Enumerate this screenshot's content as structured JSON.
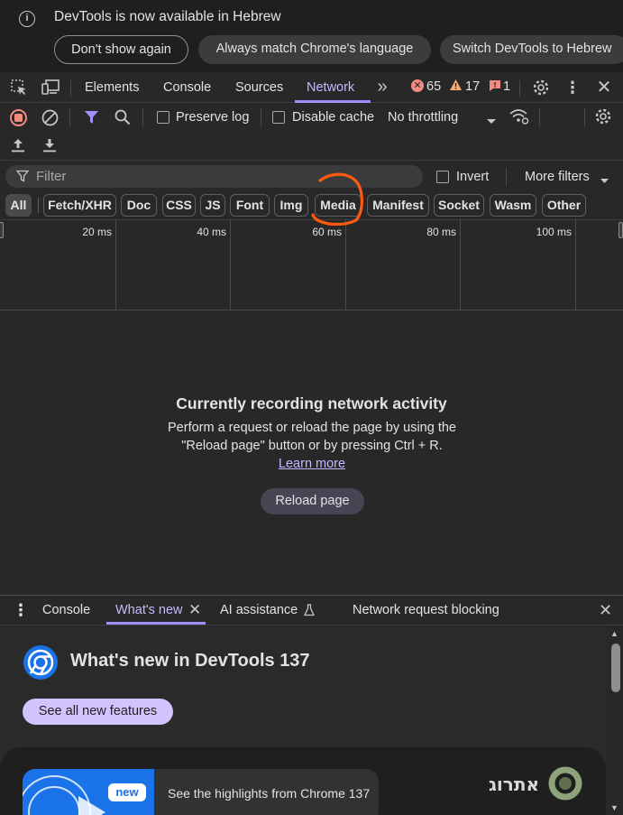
{
  "infobar": {
    "icon": "info-icon",
    "message": "DevTools is now available in Hebrew",
    "dont_show": "Don't show again",
    "always_match": "Always match Chrome's language",
    "switch": "Switch DevTools to Hebrew"
  },
  "tabs": {
    "elements": "Elements",
    "console": "Console",
    "sources": "Sources",
    "network": "Network",
    "more": "»",
    "errors": "65",
    "warnings": "17",
    "issues": "1"
  },
  "toolbar": {
    "preserve_log": "Preserve log",
    "disable_cache": "Disable cache",
    "throttling": "No throttling"
  },
  "filter": {
    "placeholder": "Filter",
    "invert": "Invert",
    "more_filters": "More filters"
  },
  "types": [
    "All",
    "Fetch/XHR",
    "Doc",
    "CSS",
    "JS",
    "Font",
    "Img",
    "Media",
    "Manifest",
    "Socket",
    "Wasm",
    "Other"
  ],
  "timeline": {
    "ticks": [
      "20 ms",
      "40 ms",
      "60 ms",
      "80 ms",
      "100 ms"
    ]
  },
  "empty": {
    "title": "Currently recording network activity",
    "description": "Perform a request or reload the page by using the \"Reload page\" button or by pressing Ctrl + R.",
    "learn_more": "Learn more",
    "reload": "Reload page"
  },
  "drawer": {
    "console": "Console",
    "whats_new": "What's new",
    "ai": "AI assistance",
    "blocking": "Network request blocking",
    "title": "What's new in DevTools 137",
    "see_all": "See all new features",
    "new_badge": "new",
    "highlight": "See the highlights from Chrome 137",
    "watermark": "אתרוג"
  },
  "colors": {
    "accent": "#a58cff",
    "error": "#f28b82",
    "warning": "#fcad70",
    "recording": "#f28b82",
    "annotation": "#ff5a12"
  }
}
